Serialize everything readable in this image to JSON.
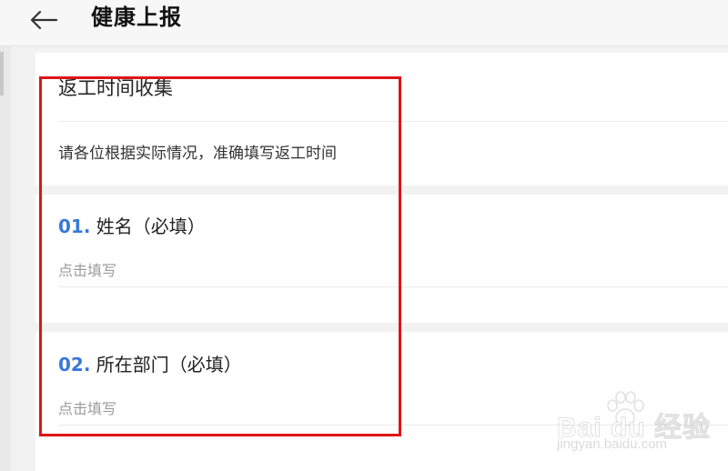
{
  "header": {
    "back_icon": "arrow-left-icon",
    "title": "健康上报"
  },
  "survey": {
    "title": "返工时间收集",
    "description": "请各位根据实际情况，准确填写返工时间"
  },
  "questions": [
    {
      "number": "01.",
      "label": "姓名（必填）",
      "placeholder": "点击填写"
    },
    {
      "number": "02.",
      "label": "所在部门（必填）",
      "placeholder": "点击填写"
    }
  ],
  "watermark": {
    "logo": "Bai du 经验",
    "url": "jingyan.baidu.com"
  },
  "colors": {
    "accent": "#3978d8",
    "highlight": "#e01414",
    "background": "#f2f2f2"
  }
}
